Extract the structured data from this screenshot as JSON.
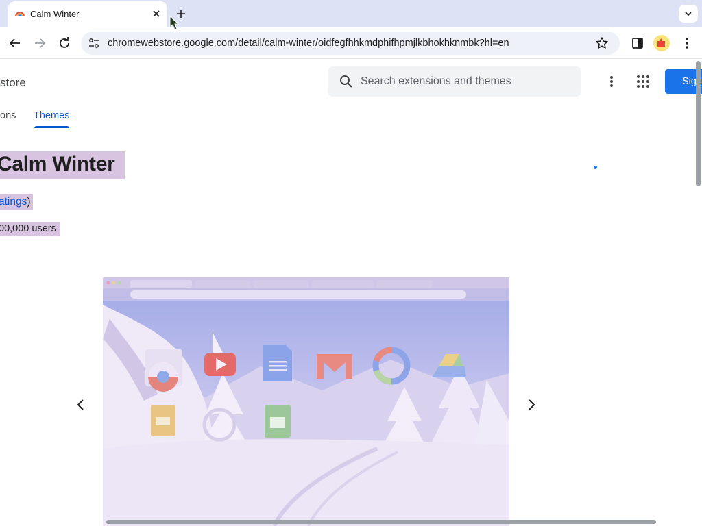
{
  "browser": {
    "tab": {
      "title": "Calm Winter",
      "favicon": "rainbow-icon"
    },
    "new_tab_icon": "plus-icon",
    "tab_search_icon": "chevron-down-icon",
    "url": "chromewebstore.google.com/detail/calm-winter/oidfegfhhkmdphifhpmjlkbhokhknmbk?hl=en"
  },
  "store": {
    "name": "store",
    "search_placeholder": "Search extensions and themes",
    "signin_label": "Sign",
    "nav": {
      "extensions": "ons",
      "themes": "Themes"
    }
  },
  "item": {
    "title": "Calm Winter",
    "ratings_link": "atings",
    "ratings_close": ")",
    "users": "00,000 users"
  },
  "colors": {
    "accent": "#0b57d0",
    "signin": "#1a73e8",
    "highlight": "#d8c3e0",
    "tabstrip": "#dde3f4"
  }
}
